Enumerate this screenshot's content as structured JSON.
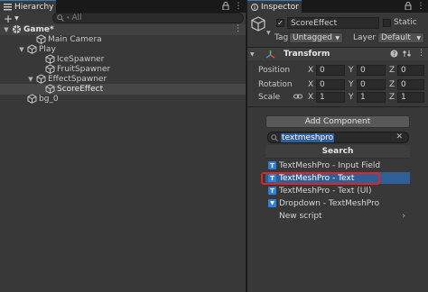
{
  "hierarchy": {
    "tab_label": "Hierarchy",
    "add_label": "+",
    "search_placeholder": "All",
    "rows": [
      {
        "label": "Game*",
        "depth": 0,
        "expanded": true,
        "scene": true
      },
      {
        "label": "Main Camera",
        "depth": 2
      },
      {
        "label": "Play",
        "depth": 1,
        "expanded": true
      },
      {
        "label": "IceSpawner",
        "depth": 3
      },
      {
        "label": "FruitSpawner",
        "depth": 3
      },
      {
        "label": "EffectSpawner",
        "depth": 2,
        "expanded": true
      },
      {
        "label": "ScoreEffect",
        "depth": 3,
        "selected": true
      },
      {
        "label": "bg_0",
        "depth": 1
      }
    ]
  },
  "inspector": {
    "tab_label": "Inspector",
    "object_name": "ScoreEffect",
    "static_label": "Static",
    "tag_label": "Tag",
    "tag_value": "Untagged",
    "layer_label": "Layer",
    "layer_value": "Default",
    "transform": {
      "title": "Transform",
      "position": {
        "label": "Position",
        "x": "0",
        "y": "0",
        "z": "0"
      },
      "rotation": {
        "label": "Rotation",
        "x": "0",
        "y": "0",
        "z": "0"
      },
      "scale": {
        "label": "Scale",
        "x": "1",
        "y": "1",
        "z": "1"
      }
    },
    "add_component": {
      "button_label": "Add Component",
      "search_value": "textmeshpro",
      "header": "Search",
      "items": [
        {
          "label": "TextMeshPro - Input Field",
          "icon": "text-icon"
        },
        {
          "label": "TextMeshPro - Text",
          "icon": "text-icon",
          "selected": true
        },
        {
          "label": "TextMeshPro - Text (UI)",
          "icon": "text-icon"
        },
        {
          "label": "Dropdown - TextMeshPro",
          "icon": "dropdown-icon"
        },
        {
          "label": "New script",
          "icon": "",
          "submenu": true
        }
      ]
    }
  },
  "colors": {
    "selection": "#2f5f96",
    "highlight_border": "#e02424",
    "tab_accent": "#3a79bb"
  }
}
